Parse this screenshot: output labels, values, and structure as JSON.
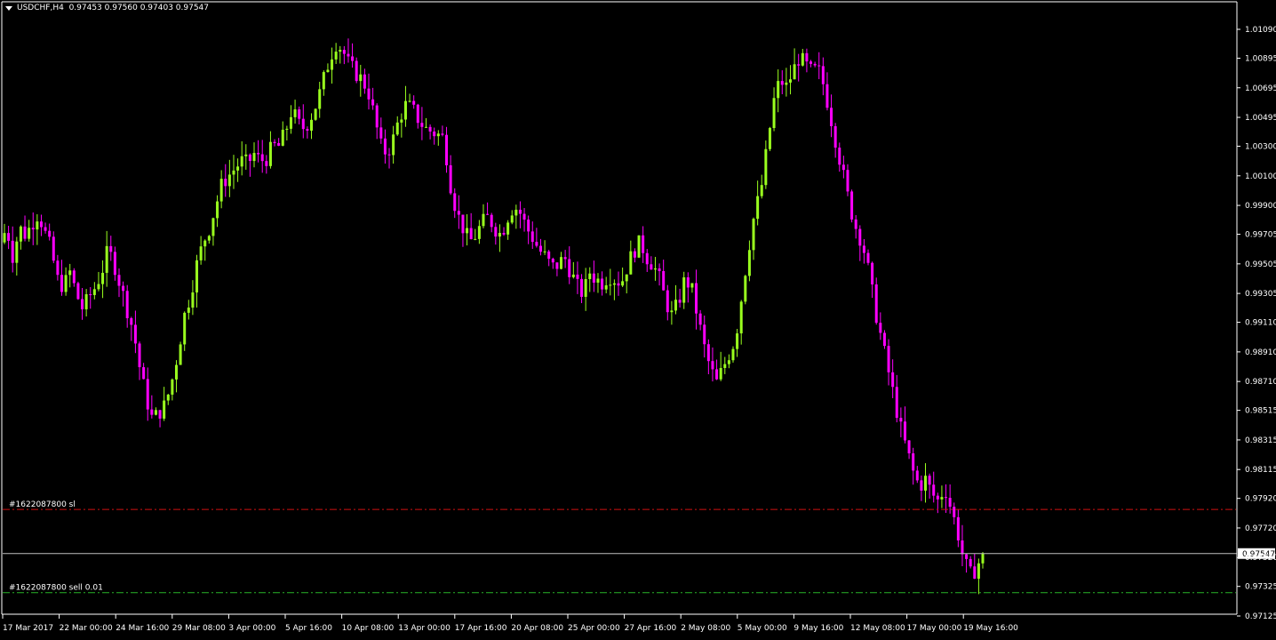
{
  "window": {
    "symbol_timeframe": "USDCHF,H4",
    "ohlc": "0.97453 0.97560 0.97403 0.97547"
  },
  "colors": {
    "background": "#000000",
    "bull_candle": "#9aff1e",
    "bear_candle": "#ff00ff",
    "grid_text": "#ffffff",
    "sl_line": "#d01010",
    "order_line": "#28b428",
    "bid_line": "#c0c0c0"
  },
  "orders": {
    "sl_label": "#1622087800 sl",
    "sl_price": 0.97845,
    "order_label": "#1622087800 sell 0.01",
    "order_price": 0.97283
  },
  "current_price": {
    "label": "0.97547",
    "value": 0.97547
  },
  "chart_data": {
    "type": "candlestick",
    "symbol": "USDCHF",
    "timeframe": "H4",
    "ylim": [
      0.97125,
      1.0117
    ],
    "y_ticks": [
      "1.01090",
      "1.00895",
      "1.00695",
      "1.00495",
      "1.00300",
      "1.00100",
      "0.99900",
      "0.99705",
      "0.99505",
      "0.99305",
      "0.99110",
      "0.98910",
      "0.98710",
      "0.98515",
      "0.98315",
      "0.98115",
      "0.97920",
      "0.97720",
      "0.97520",
      "0.97325",
      "0.97125"
    ],
    "x_ticks": [
      "17 Mar 2017",
      "22 Mar 00:00",
      "24 Mar 16:00",
      "29 Mar 08:00",
      "3 Apr 00:00",
      "5 Apr 16:00",
      "10 Apr 08:00",
      "13 Apr 00:00",
      "17 Apr 16:00",
      "20 Apr 08:00",
      "25 Apr 00:00",
      "27 Apr 16:00",
      "2 May 08:00",
      "5 May 00:00",
      "9 May 16:00",
      "12 May 08:00",
      "17 May 00:00",
      "19 May 16:00"
    ],
    "close_path": [
      0.9965,
      0.9975,
      0.9955,
      0.9975,
      0.997,
      0.9978,
      0.9985,
      0.9972,
      0.996,
      0.994,
      0.9935,
      0.9945,
      0.993,
      0.992,
      0.9928,
      0.9935,
      0.9945,
      0.996,
      0.995,
      0.9935,
      0.992,
      0.9905,
      0.988,
      0.986,
      0.9845,
      0.985,
      0.9855,
      0.987,
      0.989,
      0.9915,
      0.993,
      0.995,
      0.9965,
      0.9975,
      0.999,
      1.0005,
      1.001,
      1.0015,
      1.002,
      1.0018,
      1.0025,
      1.002,
      1.0022,
      1.003,
      1.003,
      1.004,
      1.0055,
      1.0045,
      1.0042,
      1.005,
      1.006,
      1.0075,
      1.009,
      1.01,
      1.0095,
      1.0085,
      1.008,
      1.0075,
      1.0068,
      1.005,
      1.003,
      1.0025,
      1.0035,
      1.005,
      1.0058,
      1.0055,
      1.0048,
      1.0042,
      1.004,
      1.0038,
      1.0035,
      1.0005,
      0.9985,
      0.9975,
      0.9965,
      0.997,
      0.9978,
      0.9982,
      0.9975,
      0.997,
      0.9982,
      0.999,
      0.9985,
      0.9975,
      0.9968,
      0.996,
      0.9955,
      0.9948,
      0.995,
      0.9955,
      0.9945,
      0.9935,
      0.993,
      0.9945,
      0.994,
      0.9938,
      0.9943,
      0.994,
      0.9938,
      0.995,
      0.996,
      0.9965,
      0.9955,
      0.995,
      0.994,
      0.9925,
      0.9915,
      0.9925,
      0.994,
      0.9935,
      0.9915,
      0.9895,
      0.988,
      0.987,
      0.988,
      0.989,
      0.99,
      0.993,
      0.996,
      0.9985,
      1.0,
      1.003,
      1.006,
      1.0075,
      1.007,
      1.008,
      1.009,
      1.0085,
      1.008,
      1.0082,
      1.007,
      1.005,
      1.003,
      1.001,
      0.999,
      0.9975,
      0.9965,
      0.9945,
      0.992,
      0.99,
      0.988,
      0.986,
      0.984,
      0.9825,
      0.981,
      0.98,
      0.9805,
      0.9795,
      0.979,
      0.98,
      0.9785,
      0.977,
      0.975,
      0.974,
      0.9745,
      0.97547
    ]
  }
}
